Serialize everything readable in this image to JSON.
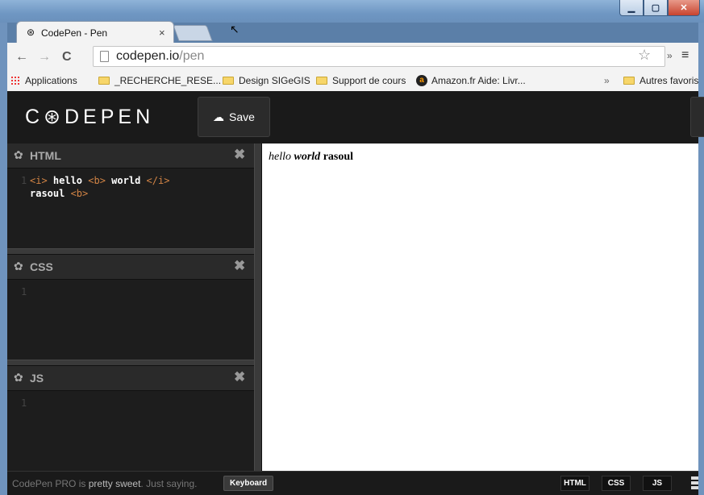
{
  "browser": {
    "tab_title": "CodePen - Pen",
    "tab_close": "×",
    "url_host": "codepen.io",
    "url_path": "/pen",
    "bookmarks": [
      {
        "label": "Applications",
        "icon": "apps-icon"
      },
      {
        "label": "_RECHERCHE_RESE...",
        "icon": "folder-icon"
      },
      {
        "label": "Design SIGeGIS",
        "icon": "folder-icon"
      },
      {
        "label": "Support de cours",
        "icon": "folder-icon"
      },
      {
        "label": "Amazon.fr Aide: Livr...",
        "icon": "amazon-icon"
      }
    ],
    "bookmarks_more": "»",
    "other_bookmarks": "Autres favoris"
  },
  "header": {
    "logo": "C⊛DEPEN",
    "save_label": "Save"
  },
  "editors": {
    "html": {
      "title": "HTML",
      "close": "✖"
    },
    "css": {
      "title": "CSS",
      "close": "✖",
      "line_numbers": [
        "1"
      ]
    },
    "js": {
      "title": "JS",
      "close": "✖",
      "line_numbers": [
        "1"
      ]
    },
    "html_code": {
      "line_number": "1",
      "t1": "<i>",
      "w1": " hello ",
      "t2": "<b>",
      "w2": " world ",
      "t3": "</i>",
      "w3": "rasoul ",
      "t4": "<b>"
    }
  },
  "preview": {
    "italic1": "hello ",
    "bolditalic": "world",
    "bold": " rasoul"
  },
  "footer": {
    "promo_start": "CodePen PRO is ",
    "promo_bold": "pretty sweet",
    "promo_end": ". Just saying.",
    "keyboard_label": "Keyboard",
    "view_html": "HTML",
    "view_css": "CSS",
    "view_js": "JS"
  },
  "colors": {
    "editor_bg": "#1d1d1d",
    "tag_color": "#d28445",
    "header_bg": "#1a1a1a"
  }
}
